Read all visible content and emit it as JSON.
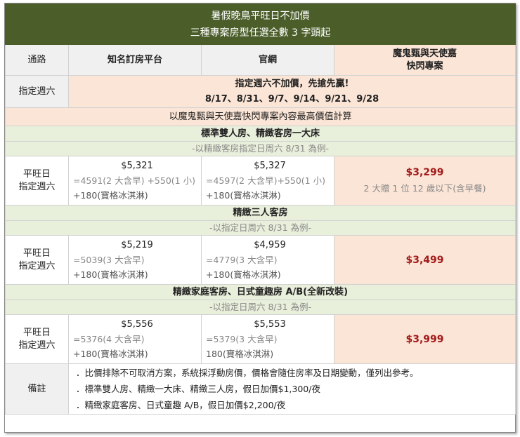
{
  "title": {
    "line1": "暑假晚鳥平旺日不加價",
    "line2": "三種專案房型任選全數 3 字頭起"
  },
  "header": {
    "route": "通路",
    "platform": "知名訂房平台",
    "official": "官網",
    "special_line1": "魔鬼甄與天使嘉",
    "special_line2": "快閃專案"
  },
  "saturday": {
    "label": "指定週六",
    "line1": "指定週六不加價，先搶先贏!",
    "line2": "8/17、8/31、9/7、9/14、9/21、9/28"
  },
  "basis": "以魔鬼甄與天使嘉快閃專案內容最高價值計算",
  "sections": [
    {
      "title": "標準雙人房、精緻客房一大床",
      "subtitle": "-以精緻客房指定日周六 8/31 為例-",
      "label1": "平旺日",
      "label2": "指定週六",
      "platform": {
        "price": "$5,321",
        "l1": "=4591(2 大含早) +550(1 小)",
        "l2": "+180(寶格冰淇淋)"
      },
      "official": {
        "price": "$5,327",
        "l1": "=4597(2 大含早)+550(1 小)",
        "l2": "+180(寶格冰淇淋)"
      },
      "special": {
        "price": "$3,299",
        "note": "2 大贈 1 位 12 歲以下(含早餐)"
      }
    },
    {
      "title": "精緻三人客房",
      "subtitle": "-以指定日周六 8/31 為例-",
      "label1": "平旺日",
      "label2": "指定週六",
      "platform": {
        "price": "$5,219",
        "l1": "=5039(3 大含早)",
        "l2": "+180(寶格冰淇淋)"
      },
      "official": {
        "price": "$4,959",
        "l1": "=4779(3 大含早)",
        "l2": "+180(寶格冰淇淋)"
      },
      "special": {
        "price": "$3,499",
        "note": ""
      }
    },
    {
      "title": "精緻家庭客房、日式童趣房 A/B(全新改裝)",
      "subtitle": "-以指定日周六 8/31 為例-",
      "label1": "平旺日",
      "label2": "指定週六",
      "platform": {
        "price": "$5,556",
        "l1": "=5376(4 大含早)",
        "l2": "+180(寶格冰淇淋)"
      },
      "official": {
        "price": "$5,553",
        "l1": "=5379(3 大含早)",
        "l2": "180(寶格冰淇淋)"
      },
      "special": {
        "price": "$3,999",
        "note": ""
      }
    }
  ],
  "remarks": {
    "label": "備註",
    "lines": [
      "．比價排除不可取消方案，系統採浮動房價，價格會隨住房率及日期變動，僅列出參考。",
      "．標準雙人房、精緻一大床、精緻三人房，假日加價$1,300/夜",
      "．精緻家庭客房、日式童趣 A/B，假日加價$2,200/夜"
    ]
  }
}
